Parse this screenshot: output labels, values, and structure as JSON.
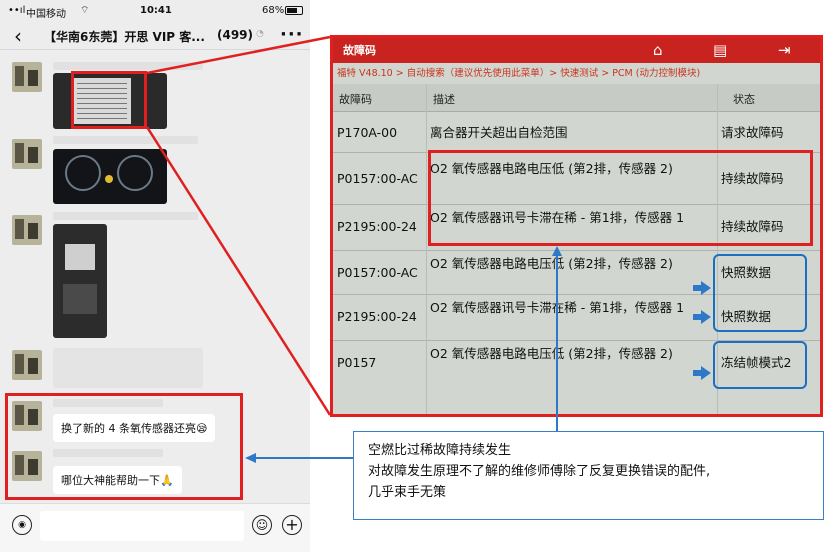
{
  "status_bar": {
    "signal": "••ıl",
    "carrier": "中国移动",
    "wifi": "⌔",
    "time": "10:41",
    "battery": "68%",
    "battery_level": 0.68
  },
  "chat_header": {
    "back": "‹",
    "title": "【华南6东莞】开思 VIP 客...",
    "count": "(499)",
    "mute_icon": "bell-off-icon",
    "more": "···"
  },
  "messages": [
    {
      "text": "换了新的 4 条氧传感器还亮😪"
    },
    {
      "text": "哪位大神能帮助一下🙏"
    }
  ],
  "input_bar": {
    "voice_icon": "voice-icon",
    "emoji_icon": "emoji-icon",
    "plus_icon": "plus-icon",
    "voice": "◉",
    "emoji": "☺",
    "plus": "+"
  },
  "diag_screen": {
    "title": "故障码",
    "icons": [
      "home-icon",
      "print-icon",
      "exit-icon"
    ],
    "icon_glyphs": [
      "⌂",
      "▤",
      "⇥"
    ],
    "breadcrumb": "福特 V48.10 > 自动搜索（建议优先使用此菜单）> 快速测试 > PCM (动力控制模块)",
    "headers": {
      "code": "故障码",
      "desc": "描述",
      "state": "状态"
    },
    "rows": [
      {
        "code": "P170A-00",
        "desc": "离合器开关超出自检范围",
        "state": "请求故障码"
      },
      {
        "code": "P0157:00-AC",
        "desc": "O2 氧传感器电路电压低 (第2排，传感器 2)",
        "state": "持续故障码"
      },
      {
        "code": "P2195:00-24",
        "desc": "O2 氧传感器讯号卡滞在稀 - 第1排，传感器 1",
        "state": "持续故障码"
      },
      {
        "code": "P0157:00-AC",
        "desc": "O2 氧传感器电路电压低 (第2排，传感器 2)",
        "state": "快照数据"
      },
      {
        "code": "P2195:00-24",
        "desc": "O2 氧传感器讯号卡滞在稀 - 第1排，传感器 1",
        "state": "快照数据"
      },
      {
        "code": "P0157",
        "desc": "O2 氧传感器电路电压低 (第2排，传感器 2)",
        "state": "冻结帧模式2"
      }
    ]
  },
  "callout": {
    "line1": "空燃比过稀故障持续发生",
    "line2": "对故障发生原理不了解的维修师傅除了反复更换错误的配件,",
    "line3": "几乎束手无策"
  },
  "colors": {
    "red_highlight": "#e02020",
    "blue_highlight": "#1a6fc0",
    "diag_title_bar": "#c92320",
    "chat_bg": "#ededed"
  }
}
